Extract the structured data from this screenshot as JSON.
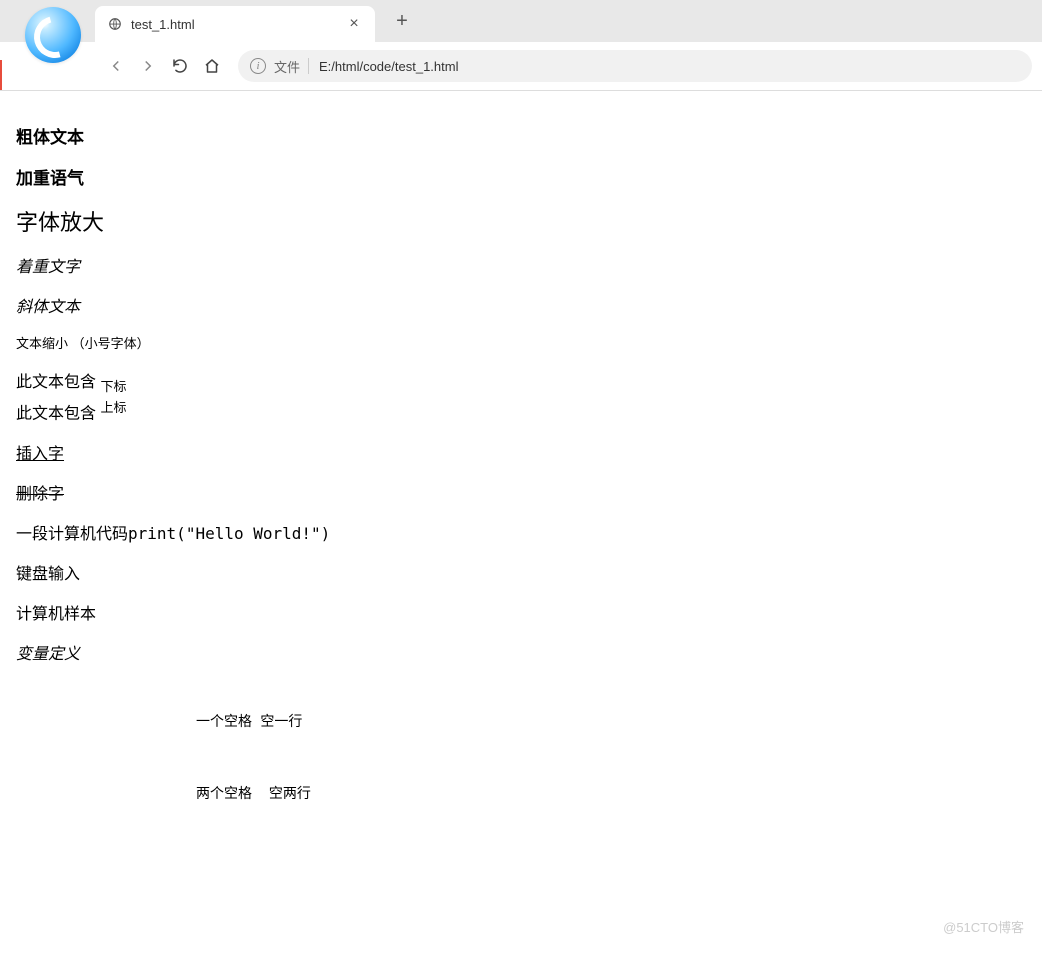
{
  "tab": {
    "title": "test_1.html",
    "close_label": "×",
    "new_tab_label": "+"
  },
  "address": {
    "file_label": "文件",
    "url": "E:/html/code/test_1.html"
  },
  "content": {
    "bold": "粗体文本",
    "strong": "加重语气",
    "big": "字体放大",
    "em": "着重文字",
    "italic": "斜体文本",
    "small_main": "文本缩小",
    "small_note": "（小号字体）",
    "sub_prefix": "此文本包含",
    "sub_text": "下标",
    "sup_prefix": "此文本包含",
    "sup_text": "上标",
    "ins": "插入字",
    "del": "删除字",
    "code_prefix": "一段计算机代码",
    "code_text": "print(\"Hello World!\")",
    "kbd": "键盘输入",
    "samp": "计算机样本",
    "var": "变量定义",
    "pre_line1": "一个空格 空一行",
    "pre_line2": "两个空格  空两行"
  },
  "watermark": "@51CTO博客"
}
